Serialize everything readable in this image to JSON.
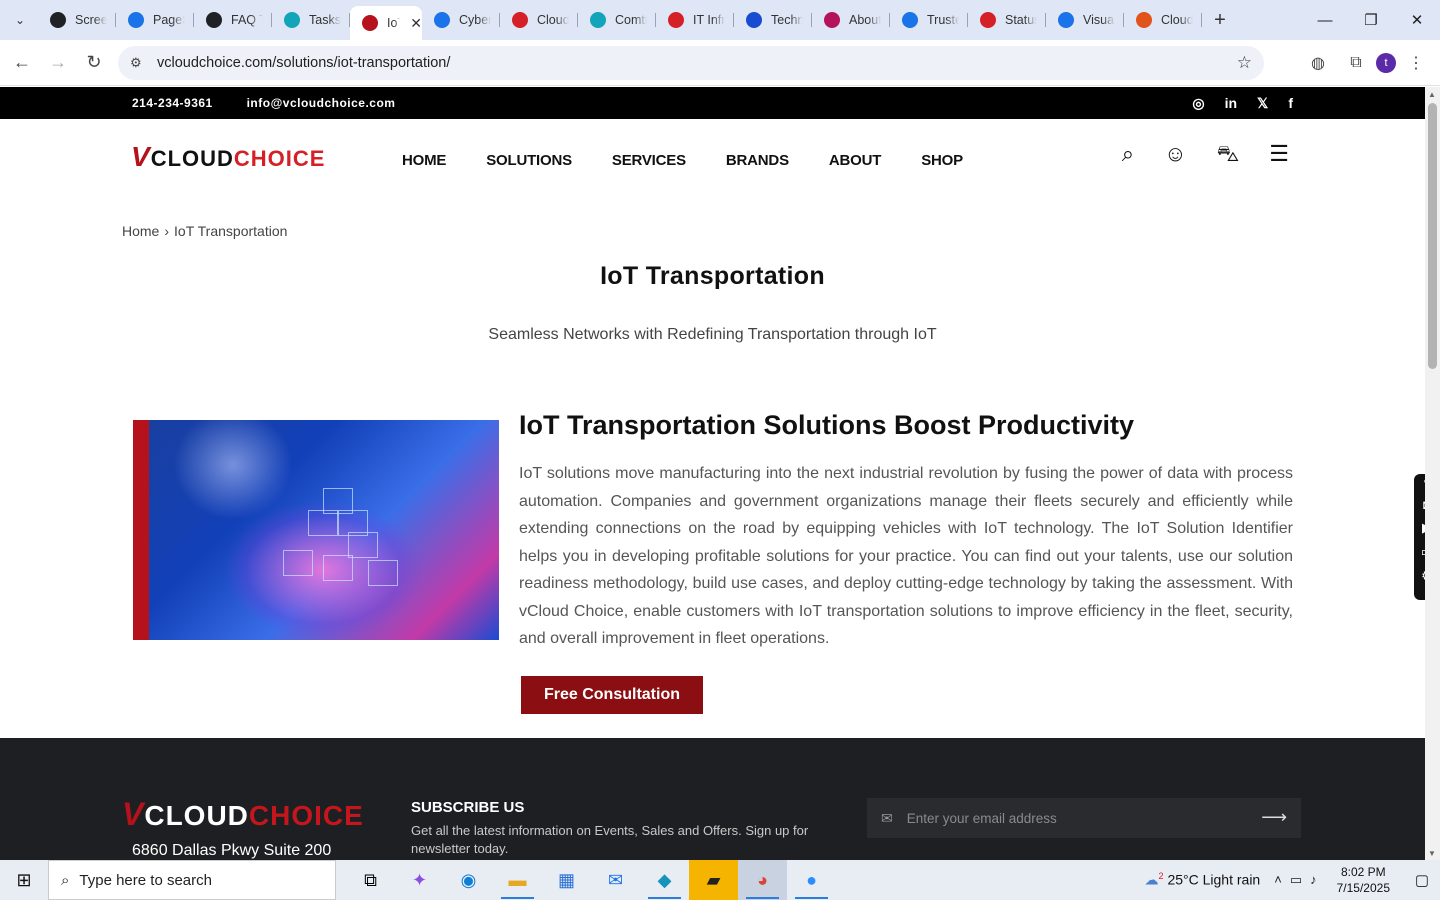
{
  "browser": {
    "tabs": [
      {
        "label": "Screencast",
        "color": "#202124"
      },
      {
        "label": "PageSpeed",
        "color": "#1a73e8"
      },
      {
        "label": "FAQ Tasks",
        "color": "#202124"
      },
      {
        "label": "Tasks",
        "color": "#12a4b8"
      },
      {
        "label": "IoT",
        "color": "#b5121b",
        "active": true
      },
      {
        "label": "Cybersecurity",
        "color": "#1a73e8"
      },
      {
        "label": "Cloud",
        "color": "#d62027"
      },
      {
        "label": "Comtrade",
        "color": "#12a4b8"
      },
      {
        "label": "IT Infra",
        "color": "#d62027"
      },
      {
        "label": "Technology",
        "color": "#1a4cd1"
      },
      {
        "label": "About",
        "color": "#b5125e"
      },
      {
        "label": "Trusted",
        "color": "#1a73e8"
      },
      {
        "label": "Status",
        "color": "#d62027"
      },
      {
        "label": "Visual",
        "color": "#1a73e8"
      },
      {
        "label": "Cloud",
        "color": "#e0531b"
      }
    ],
    "url": "vcloudchoice.com/solutions/iot-transportation/",
    "profile_initial": "t"
  },
  "site": {
    "phone": "214-234-9361",
    "email": "info@vcloudchoice.com",
    "social": [
      "instagram",
      "linkedin",
      "x",
      "facebook"
    ],
    "logo": {
      "v": "V",
      "part1": "CLOUD",
      "part2": "CHOICE"
    },
    "nav": [
      "HOME",
      "SOLUTIONS",
      "SERVICES",
      "BRANDS",
      "ABOUT",
      "SHOP"
    ],
    "breadcrumb": {
      "home": "Home",
      "sep": "›",
      "current": "IoT Transportation"
    },
    "page_title": "IoT Transportation",
    "page_subtitle": "Seamless Networks with Redefining Transportation through IoT",
    "section_title": "IoT Transportation Solutions Boost Productivity",
    "section_body": "IoT solutions move manufacturing into the next industrial revolution by fusing the power of data with process automation. Companies and government organizations manage their fleets securely and efficiently while extending connections on the road by equipping vehicles with IoT technology. The IoT Solution Identifier helps you in developing profitable solutions for your practice. You can find out your talents, use our solution readiness methodology, build use cases, and deploy cutting-edge technology by taking the assessment. With vCloud Choice, enable customers with IoT transportation solutions to improve efficiency in the fleet, security, and overall improvement in fleet operations.",
    "cta": "Free Consultation",
    "footer": {
      "address": "6860 Dallas Pkwy Suite 200",
      "subscribe_title": "SUBSCRIBE US",
      "subscribe_text": "Get all the latest information on Events, Sales and Offers. Sign up for newsletter today.",
      "email_placeholder": "Enter your email address"
    }
  },
  "taskbar": {
    "search_placeholder": "Type here to search",
    "weather": "25°C  Light rain",
    "weather_badge": "2",
    "time": "8:02 PM",
    "date": "7/15/2025"
  },
  "colors": {
    "brand_red": "#b5121b",
    "cta": "#8b0e12",
    "footer_bg": "#1e1f22"
  }
}
